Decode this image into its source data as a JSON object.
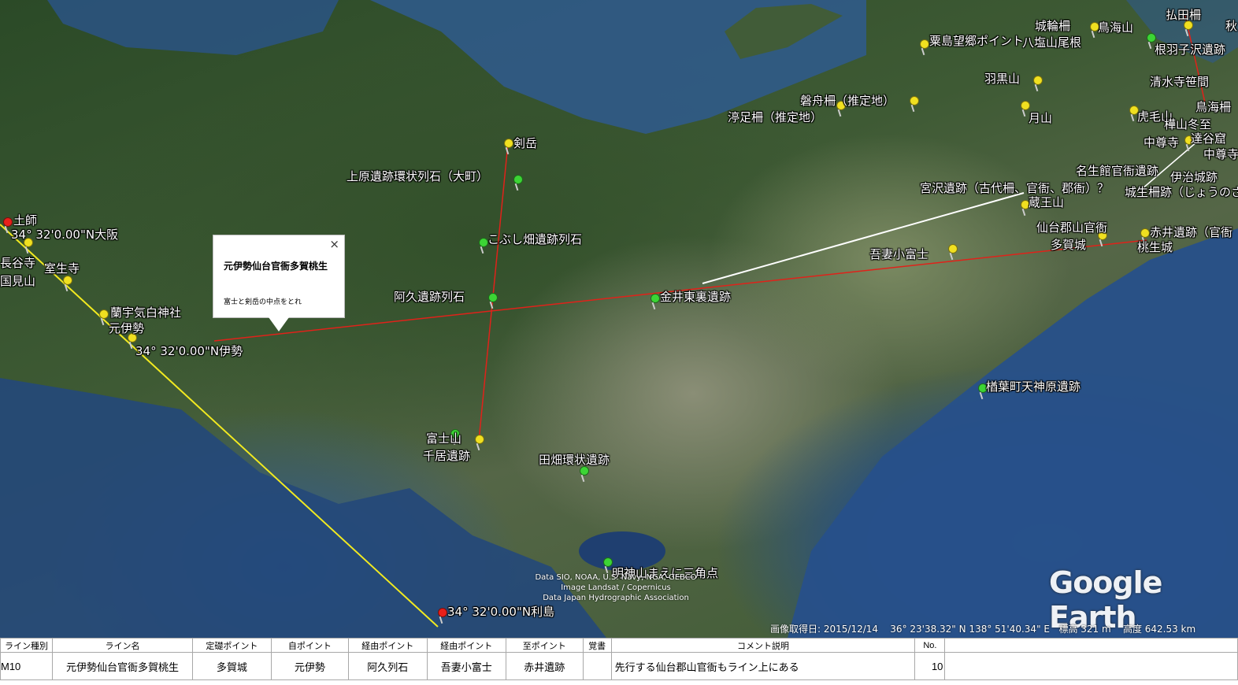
{
  "popup": {
    "title": "元伊勢仙台官衙多賀桃生",
    "description": "富士と剣岳の中点をとれ",
    "close_label": "×"
  },
  "map_labels": [
    {
      "id": "tsurugi",
      "text": "剣岳"
    },
    {
      "id": "uehara",
      "text": "上原遺跡環状列石（大町）"
    },
    {
      "id": "kobushi",
      "text": "こぶし畑遺跡列石"
    },
    {
      "id": "akyu",
      "text": "阿久遺跡列石"
    },
    {
      "id": "kanai",
      "text": "金井東裏遺跡"
    },
    {
      "id": "fuji",
      "text": "富士山"
    },
    {
      "id": "chii",
      "text": "千居遺跡"
    },
    {
      "id": "tabata",
      "text": "田畑環状遺跡"
    },
    {
      "id": "myojin",
      "text": "明神山まえに三角点"
    },
    {
      "id": "toshima",
      "text": "34° 32'0.00\"N利島"
    },
    {
      "id": "ise",
      "text": "34° 32'0.00\"N伊勢"
    },
    {
      "id": "osaka",
      "text": "34° 32'0.00\"N大阪"
    },
    {
      "id": "hashi",
      "text": "土師"
    },
    {
      "id": "hase",
      "text": "長谷寺"
    },
    {
      "id": "kunimi",
      "text": "国見山"
    },
    {
      "id": "muro",
      "text": "室生寺"
    },
    {
      "id": "rangu",
      "text": "蘭宇気白神社"
    },
    {
      "id": "motoise",
      "text": "元伊勢"
    },
    {
      "id": "azuma",
      "text": "吾妻小富士"
    },
    {
      "id": "miyazawa",
      "text": "宮沢遺跡（古代柵、官衙、郡衙）？"
    },
    {
      "id": "zao",
      "text": "蔵王山"
    },
    {
      "id": "sendai",
      "text": "仙台郡山官衙"
    },
    {
      "id": "taga",
      "text": "多賀城"
    },
    {
      "id": "akai",
      "text": "赤井遺跡（官衙"
    },
    {
      "id": "momo",
      "text": "桃生城"
    },
    {
      "id": "naraha",
      "text": "楢葉町天神原遺跡"
    },
    {
      "id": "nuttari",
      "text": "渟足柵（推定地）"
    },
    {
      "id": "iwafune",
      "text": "磐舟柵（推定地）"
    },
    {
      "id": "awashima",
      "text": "粟島望郷ポイント"
    },
    {
      "id": "jowa",
      "text": "城輪柵"
    },
    {
      "id": "chokai",
      "text": "鳥海山"
    },
    {
      "id": "hachien",
      "text": "八塩山尾根"
    },
    {
      "id": "hotta",
      "text": "払田柵"
    },
    {
      "id": "nehazawa",
      "text": "根羽子沢遺跡"
    },
    {
      "id": "haguro",
      "text": "羽黒山"
    },
    {
      "id": "gassan",
      "text": "月山"
    },
    {
      "id": "shimizu",
      "text": "清水寺笹間"
    },
    {
      "id": "torami",
      "text": "虎毛山"
    },
    {
      "id": "chusonji",
      "text": "中尊寺"
    },
    {
      "id": "tonoyama",
      "text": "樺山冬至"
    },
    {
      "id": "tatsuya",
      "text": "達谷窟"
    },
    {
      "id": "chuson2",
      "text": "中尊寺"
    },
    {
      "id": "nanshodan",
      "text": "名生館官衙遺跡"
    },
    {
      "id": "iji",
      "text": "伊治城跡"
    },
    {
      "id": "josei",
      "text": "城生柵跡（じょうのさ"
    },
    {
      "id": "toriumi",
      "text": "鳥海柵"
    },
    {
      "id": "hi",
      "text": "秋"
    }
  ],
  "attribution": [
    "Data SIO, NOAA, U.S. Navy, NGA, GEBCO",
    "Image Landsat / Copernicus",
    "Data Japan Hydrographic Association"
  ],
  "logo": "Google Earth",
  "status": {
    "imagery_date": "画像取得日: 2015/12/14",
    "coords": "36° 23'38.32\" N 138° 51'40.34\" E",
    "elevation": "標高 321 m",
    "altitude": "高度 642.53 km"
  },
  "sheet": {
    "headers": [
      "ライン種別",
      "ライン名",
      "定礎ポイント",
      "自ポイント",
      "経由ポイント",
      "経由ポイント",
      "至ポイント",
      "覚書",
      "コメント説明",
      "No.",
      ""
    ],
    "row": [
      "M10",
      "元伊勢仙台官衙多賀桃生",
      "多賀城",
      "元伊勢",
      "阿久列石",
      "吾妻小富士",
      "赤井遺跡",
      "",
      "先行する仙台郡山官衙もライン上にある",
      "10",
      ""
    ]
  },
  "colors": {
    "line_red": "#e0221a",
    "line_yellow": "#f2ea20",
    "line_white": "#ffffff",
    "header_highlight": "#ffff00"
  }
}
